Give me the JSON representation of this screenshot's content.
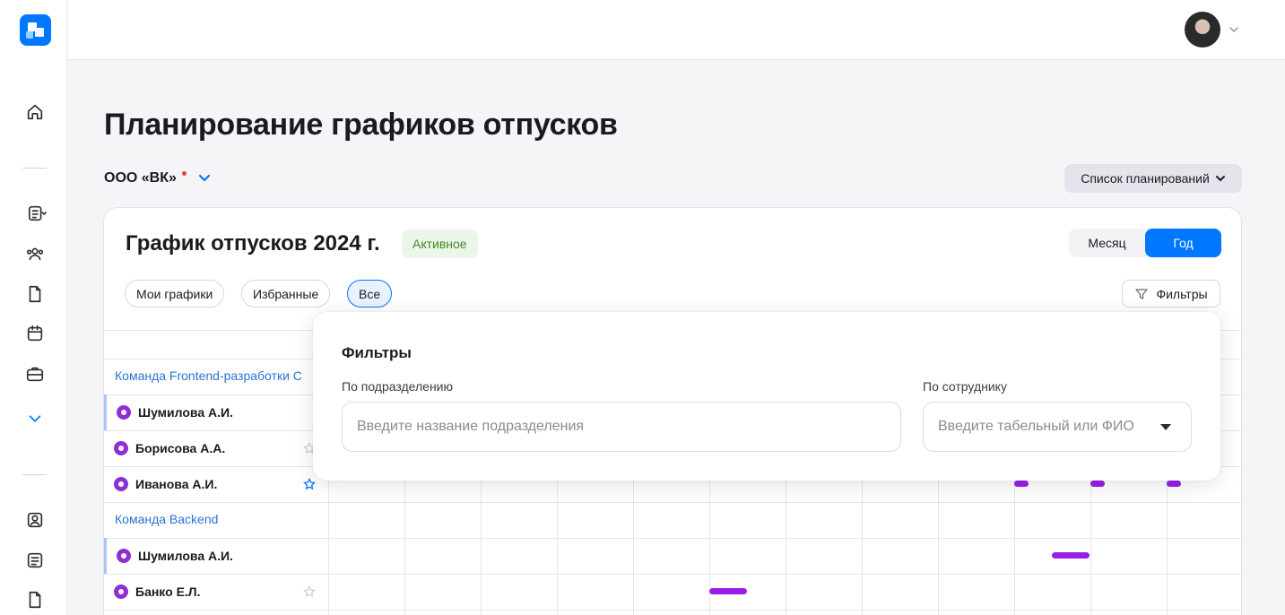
{
  "header": {
    "title": "Планирование графиков отпусков",
    "org": "ООО «ВК»",
    "plans_button": "Список планирований"
  },
  "card": {
    "title": "График отпусков 2024 г.",
    "status": "Активное",
    "view": {
      "month": "Месяц",
      "year": "Год"
    },
    "chips": [
      "Мои графики",
      "Избранные",
      "Все"
    ],
    "filters_button": "Фильтры"
  },
  "teams": [
    {
      "name": "Команда Frontend-разработки С"
    },
    {
      "name": "Команда Backend"
    }
  ],
  "employees": [
    {
      "name": "Шумилова А.И."
    },
    {
      "name": "Борисова А.А."
    },
    {
      "name": "Иванова А.И."
    },
    {
      "name": "Шумилова А.И."
    },
    {
      "name": "Банко Е.Л."
    }
  ],
  "filter_popover": {
    "title": "Фильтры",
    "department_label": "По подразделению",
    "department_placeholder": "Введите название подразделения",
    "employee_label": "По сотруднику",
    "employee_placeholder": "Введите табельный или ФИО"
  },
  "colors": {
    "accent": "#0077ff",
    "vacation": "#9a1ee9",
    "team_link": "#2a72d6",
    "active_badge_bg": "#ecf6e8"
  }
}
